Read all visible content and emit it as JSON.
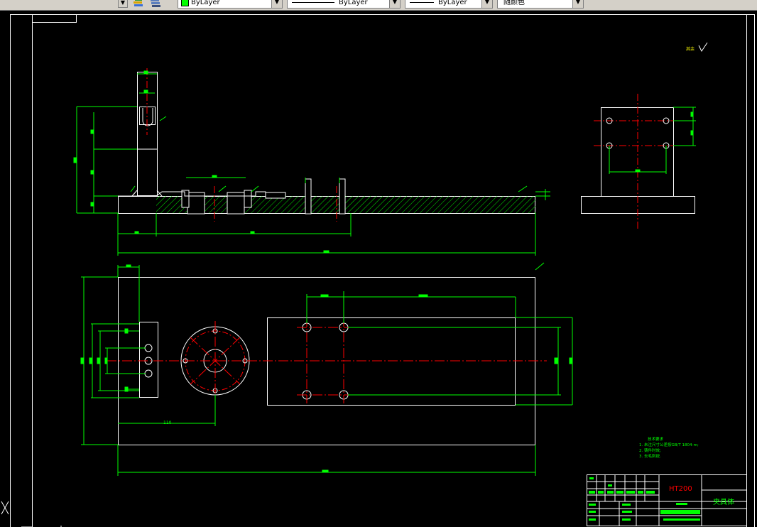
{
  "toolbar": {
    "layer_color_value": "ByLayer",
    "linetype_value": "ByLayer",
    "lineweight_value": "ByLayer",
    "plotstyle_value": "随颜色"
  },
  "drawing": {
    "roughness_mark": "其余",
    "tech_req_title": "技术要求",
    "tech_req_items": [
      "1. 未注尺寸公差按GB/T 1804-m;",
      "2. 铸件时效;",
      "3. 去毛刺锐."
    ],
    "dims": {
      "front_total": "450",
      "plan_total": "450",
      "plan_110": "110",
      "plan_320": "320",
      "side_230": "230"
    },
    "title_block": {
      "material": "HT200",
      "part_name": "夹具体"
    }
  },
  "colors": {
    "background": "#000000",
    "outline": "#ffffff",
    "dimension": "#00ff00",
    "centerline": "#ff0000",
    "hatch": "#00ff00"
  }
}
